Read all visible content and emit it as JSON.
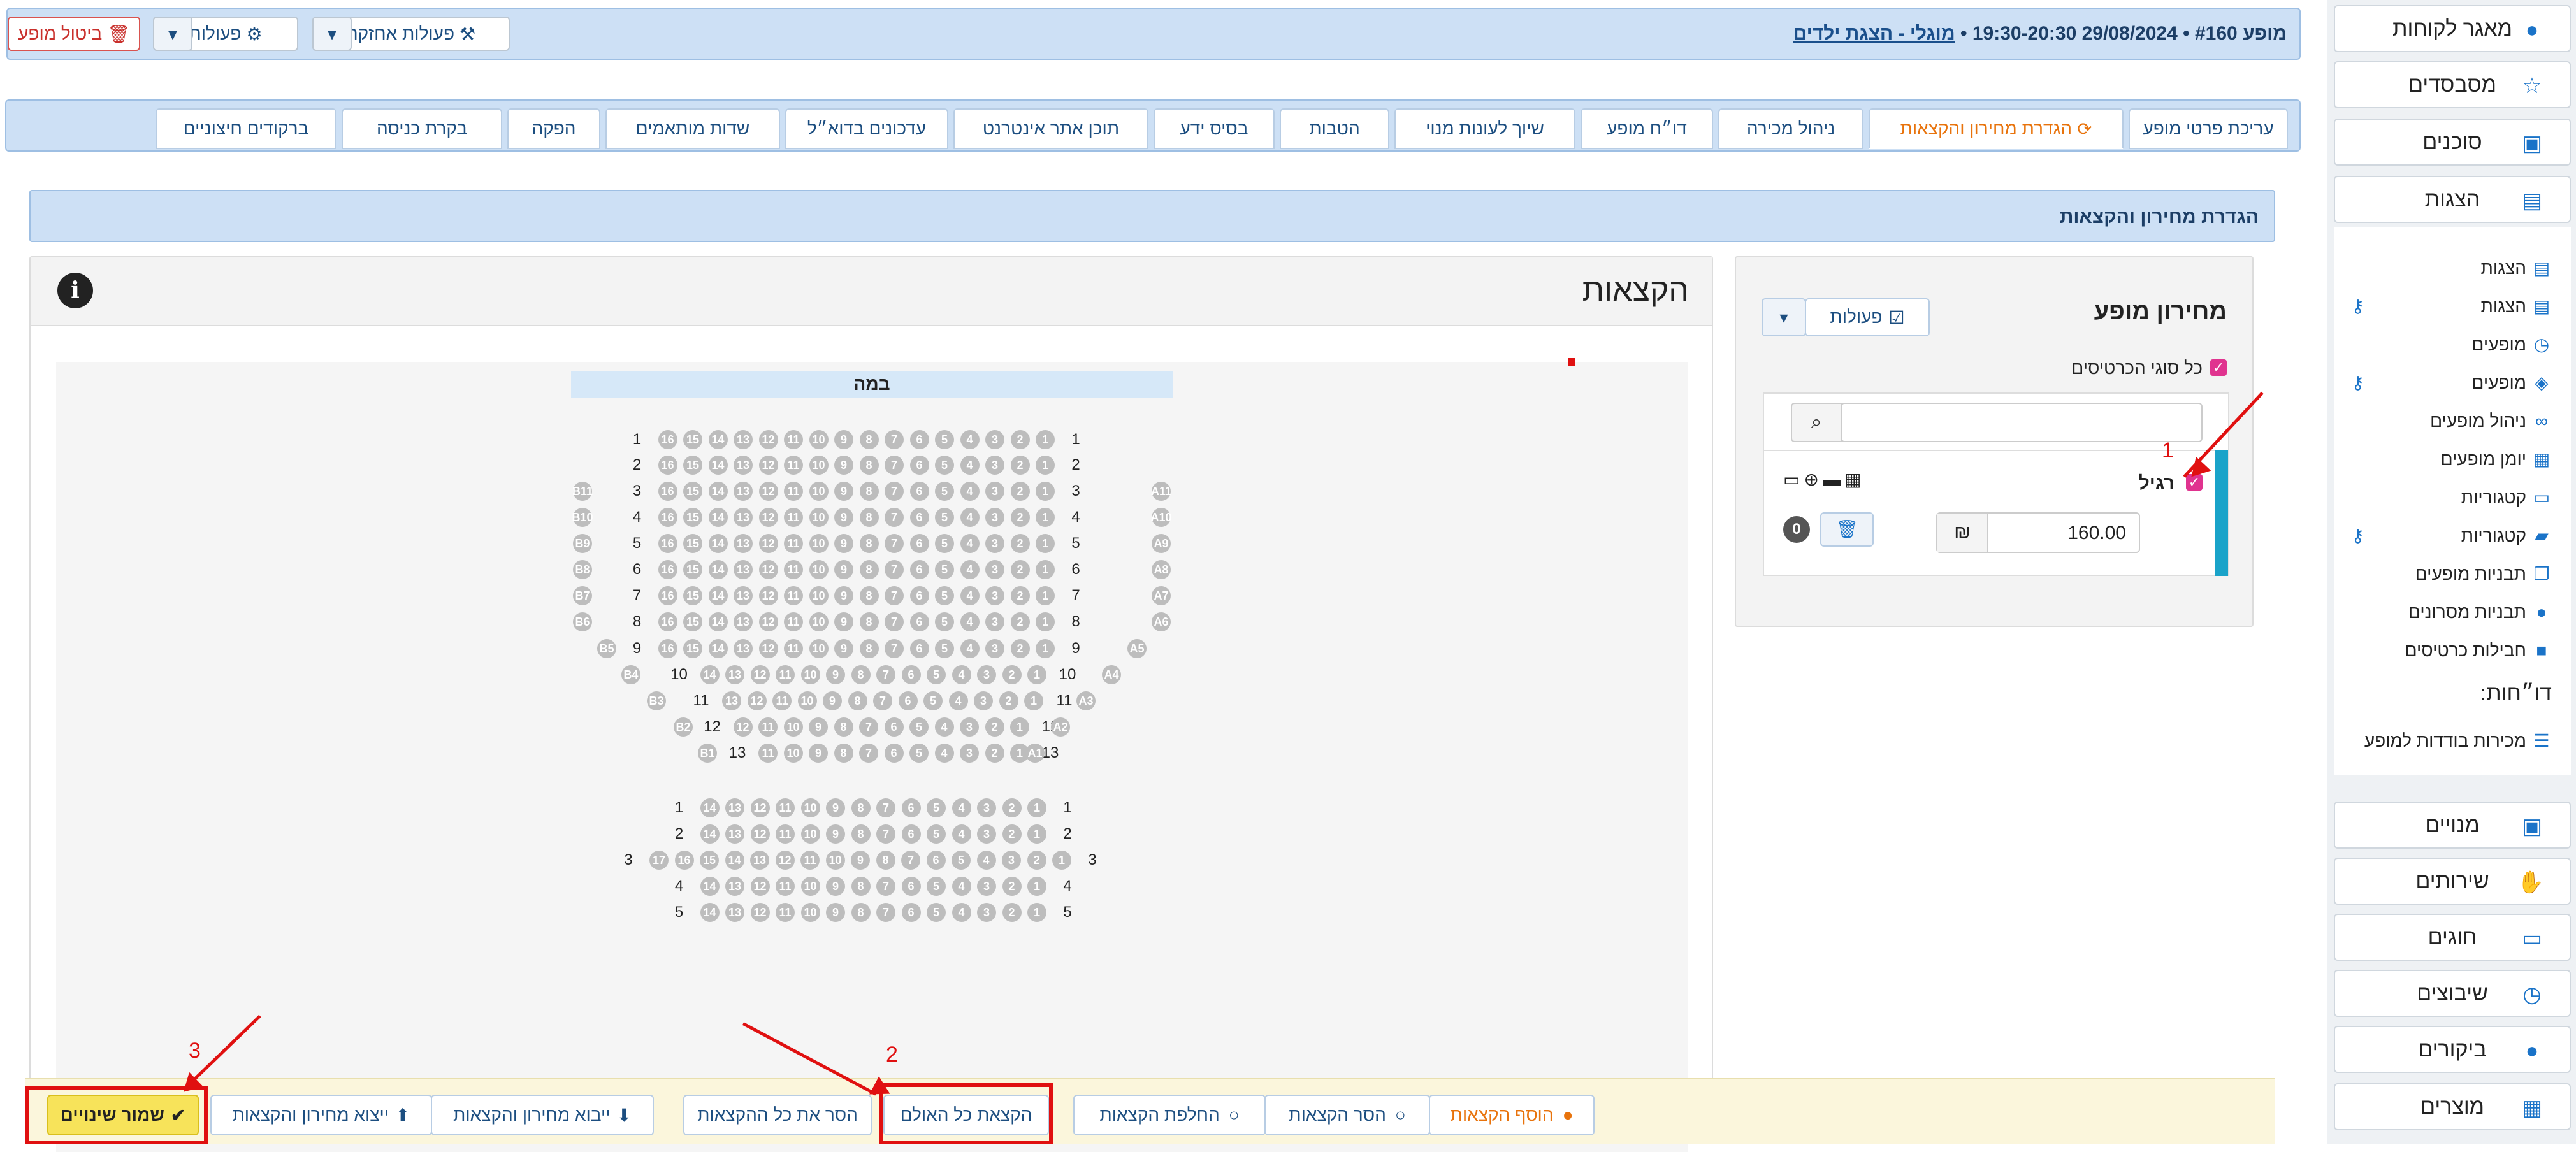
{
  "sidebar": {
    "top_items": [
      {
        "label": "מאגר לקוחות",
        "icon": "user-circle-icon"
      },
      {
        "label": "מסבסדים",
        "icon": "star-icon"
      },
      {
        "label": "סוכנים",
        "icon": "briefcase-icon"
      },
      {
        "label": "הצגות",
        "icon": "film-icon"
      }
    ],
    "sub_items": [
      {
        "label": "הצגות",
        "icon": "film-icon",
        "key": false
      },
      {
        "label": "הצגות",
        "icon": "film-icon",
        "key": true
      },
      {
        "label": "מופעים",
        "icon": "clock-icon",
        "key": false
      },
      {
        "label": "מופעים",
        "icon": "shield-clock-icon",
        "key": true
      },
      {
        "label": "ניהול מופעים",
        "icon": "binoculars-icon",
        "key": false
      },
      {
        "label": "יומן מופעים",
        "icon": "calendar-icon",
        "key": false
      },
      {
        "label": "קטגוריות",
        "icon": "folder-icon",
        "key": false
      },
      {
        "label": "קטגוריות",
        "icon": "folder-open-icon",
        "key": true
      },
      {
        "label": "תבניות מופעים",
        "icon": "copy-icon",
        "key": false
      },
      {
        "label": "תבניות מסרונים",
        "icon": "chat-icon",
        "key": false
      },
      {
        "label": "חבילות כרטיסים",
        "icon": "box-icon",
        "key": false
      }
    ],
    "reports_heading": "דו״חות:",
    "report_item": "מכירות בודדות למופע",
    "bottom_items": [
      {
        "label": "מנויים",
        "icon": "id-card-icon"
      },
      {
        "label": "שירותים",
        "icon": "handshake-icon"
      },
      {
        "label": "חוגים",
        "icon": "chalkboard-icon"
      },
      {
        "label": "שיבוצים",
        "icon": "clock-icon"
      },
      {
        "label": "ביקורים",
        "icon": "footsteps-icon"
      },
      {
        "label": "מוצרים",
        "icon": "boxes-icon"
      }
    ]
  },
  "header": {
    "show_prefix": "מופע #160 • 29/08/2024 19:30-20:30 • ",
    "show_link": "מוגלי - הצגת ילדים",
    "maintenance_btn": "פעולות אחזקה",
    "actions_btn": "פעולות",
    "cancel_btn": "ביטול מופע"
  },
  "tabs": [
    "עריכת פרטי מופע",
    "הגדרת מחירון והקצאות",
    "ניהול מכירה",
    "דו״ח מופע",
    "שיוך לעונות מנוי",
    "הטבות",
    "בסיס ידע",
    "תוכן אתר אינטרנט",
    "עדכונים בדוא״ל",
    "שדות מותאמים",
    "הפקה",
    "בקרת כניסה",
    "ברקודים חיצוניים"
  ],
  "section_title": "הגדרת מחירון והקצאות",
  "pricing": {
    "title": "מחירון מופע",
    "actions_btn": "פעולות",
    "all_types_label": "כל סוגי הכרטיסים",
    "search_placeholder": "",
    "ticket_name": "רגיל",
    "price": "160.00",
    "currency": "₪",
    "count": "0"
  },
  "allocations": {
    "title": "הקצאות",
    "stage_label": "במה"
  },
  "bottom_buttons": {
    "add": "הוסף הקצאות",
    "remove": "הסר הקצאות",
    "swap": "החלפת הקצאות",
    "allocate_all": "הקצאת כל האולם",
    "remove_all": "הסר את כל ההקצאות",
    "import": "ייבוא מחירון והקצאות",
    "export": "ייצוא מחירון והקצאות",
    "save": "שמור שינויים"
  },
  "annotations": [
    "1",
    "2",
    "3"
  ],
  "colors": {
    "accent": "#1a73c8",
    "orange": "#e8730c",
    "red": "#e01010",
    "seat": "#bdbdbd"
  }
}
